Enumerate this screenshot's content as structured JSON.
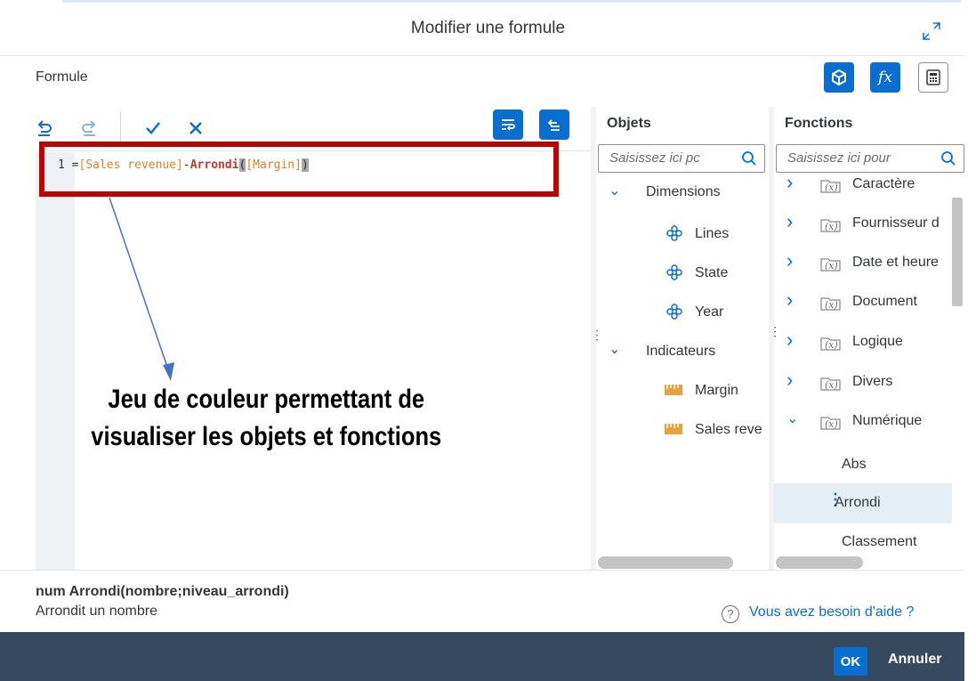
{
  "dialog": {
    "title": "Modifier une formule"
  },
  "formula": {
    "label": "Formule",
    "line_number": "1",
    "equals": "=",
    "obj1": "[Sales revenue]",
    "minus": "-",
    "func": "Arrondi",
    "open_paren": "(",
    "obj2": "[Margin]",
    "close_paren": ")"
  },
  "objects_panel": {
    "title": "Objets",
    "search_placeholder": "Saisissez ici pc",
    "groups": [
      {
        "label": "Dimensions",
        "items": [
          "Lines",
          "State",
          "Year"
        ]
      },
      {
        "label": "Indicateurs",
        "items": [
          "Margin",
          "Sales reve"
        ]
      }
    ]
  },
  "functions_panel": {
    "title": "Fonctions",
    "search_placeholder": "Saisissez ici pour",
    "categories": [
      "Caractère",
      "Fournisseur d",
      "Date et heure",
      "Document",
      "Logique",
      "Divers",
      "Numérique"
    ],
    "numeric_items": [
      "Abs",
      "Arrondi",
      "Classement"
    ],
    "selected": "Arrondi"
  },
  "annotation": {
    "line1": "Jeu de couleur permettant de",
    "line2": "visualiser les objets et fonctions"
  },
  "footer": {
    "signature": "num Arrondi(nombre;niveau_arrondi)",
    "description": "Arrondit un nombre",
    "help_icon": "?",
    "help_link": "Vous avez besoin d'aide ?",
    "ok_label": "OK",
    "cancel_label": "Annuler"
  },
  "colors": {
    "accent": "#0a6ed1",
    "highlight_border": "#c00000",
    "object_text": "#e67e22",
    "function_text": "#c0392b",
    "footer_bar": "#354a5f"
  }
}
